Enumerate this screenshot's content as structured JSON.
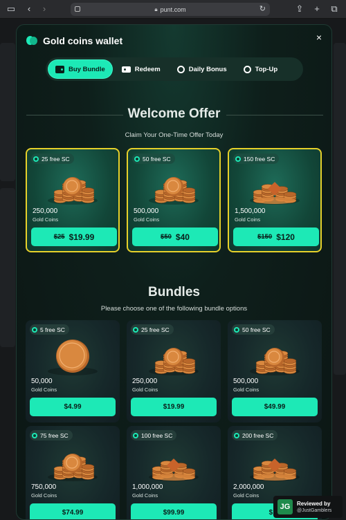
{
  "browser": {
    "url": "punt.com"
  },
  "modal": {
    "title": "Gold coins wallet",
    "close": "×",
    "tabs": [
      {
        "label": "Buy Bundle",
        "icon": "wallet-icon",
        "active": true
      },
      {
        "label": "Redeem",
        "icon": "ticket-icon",
        "active": false
      },
      {
        "label": "Daily Bonus",
        "icon": "clock-icon",
        "active": false
      },
      {
        "label": "Top-Up",
        "icon": "clock-icon",
        "active": false
      }
    ]
  },
  "welcome": {
    "title": "Welcome Offer",
    "subtitle": "Claim Your One-Time Offer Today",
    "offers": [
      {
        "badge": "25 free SC",
        "amount": "250,000",
        "unit": "Gold Coins",
        "old_price": "$25",
        "price": "$19.99"
      },
      {
        "badge": "50 free SC",
        "amount": "500,000",
        "unit": "Gold Coins",
        "old_price": "$50",
        "price": "$40"
      },
      {
        "badge": "150 free SC",
        "amount": "1,500,000",
        "unit": "Gold Coins",
        "old_price": "$150",
        "price": "$120"
      }
    ]
  },
  "bundles": {
    "title": "Bundles",
    "subtitle": "Please choose one of the following bundle options",
    "items": [
      {
        "badge": "5 free SC",
        "amount": "50,000",
        "unit": "Gold Coins",
        "price": "$4.99"
      },
      {
        "badge": "25 free SC",
        "amount": "250,000",
        "unit": "Gold Coins",
        "price": "$19.99"
      },
      {
        "badge": "50 free SC",
        "amount": "500,000",
        "unit": "Gold Coins",
        "price": "$49.99"
      },
      {
        "badge": "75 free SC",
        "amount": "750,000",
        "unit": "Gold Coins",
        "price": "$74.99"
      },
      {
        "badge": "100 free SC",
        "amount": "1,000,000",
        "unit": "Gold Coins",
        "price": "$99.99"
      },
      {
        "badge": "200 free SC",
        "amount": "2,000,000",
        "unit": "Gold Coins",
        "price": "$19"
      }
    ]
  },
  "review_badge": {
    "line1": "Reviewed by",
    "line2": "@JustGamblers",
    "logo": "JG"
  },
  "colors": {
    "accent": "#1de9b6",
    "offer_border": "#e7d12a",
    "coin": "#d9883f"
  }
}
